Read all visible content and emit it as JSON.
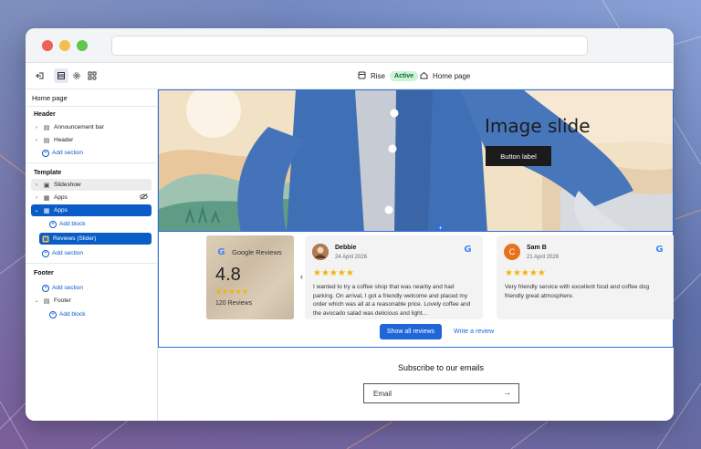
{
  "toolbar": {
    "theme_name": "Rise",
    "theme_status": "Active",
    "page_name": "Home page"
  },
  "sidebar": {
    "title": "Home page",
    "header_group": {
      "heading": "Header",
      "items": [
        {
          "label": "Announcement bar"
        },
        {
          "label": "Header"
        }
      ],
      "add_section": "Add section"
    },
    "template_group": {
      "heading": "Template",
      "slideshow": "Slideshow",
      "apps_hidden": "Apps",
      "apps_selected": "Apps",
      "add_block_1": "Add block",
      "reviews_block": "Reviews (Slider)",
      "add_section": "Add section"
    },
    "footer_group": {
      "heading": "Footer",
      "add_section": "Add section",
      "footer_item": "Footer",
      "add_block": "Add block"
    }
  },
  "hero": {
    "title": "Image slide",
    "button_label": "Button label"
  },
  "reviews": {
    "summary": {
      "source": "Google Reviews",
      "rating": "4.8",
      "stars": "★★★★★",
      "count": "120 Reviews"
    },
    "cards": [
      {
        "name": "Debbie",
        "initial": "",
        "date": "24 April 2026",
        "stars": "★★★★★",
        "text": "I wanted to try a coffee shop that was nearby and had parking. On arrival, I got a friendly welcome and placed my order which was all at a reasonable price. Lovely coffee and the avocado salad was delicious and light...",
        "avatar_color": "#8a5a3c"
      },
      {
        "name": "Sam B",
        "initial": "C",
        "date": "21 April 2026",
        "stars": "★★★★★",
        "text": "Very friendly service with excellent food and coffee dog friendly great atmosphere.",
        "avatar_color": "#e8711c"
      }
    ],
    "show_all_label": "Show all reviews",
    "write_review_label": "Write a review"
  },
  "newsletter": {
    "heading": "Subscribe to our emails",
    "email_placeholder": "Email"
  },
  "colors": {
    "accent": "#0a5cc7",
    "button_blue": "#2066d9",
    "star": "#f3b400",
    "active_badge_bg": "#cdf2d6"
  }
}
